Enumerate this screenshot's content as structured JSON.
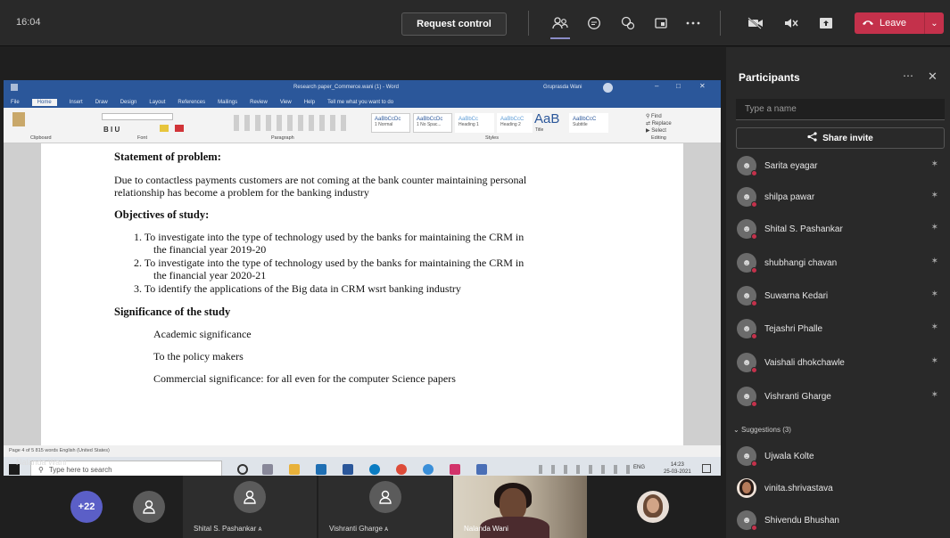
{
  "topbar": {
    "time": "16:04",
    "request_control": "Request control",
    "leave": "Leave",
    "icons": [
      "participants-icon",
      "chat-icon",
      "reactions-icon",
      "rooms-icon",
      "more-icon",
      "camera-off-icon",
      "mic-off-icon",
      "share-tray-icon"
    ]
  },
  "shared_screen": {
    "word_title": "Research paper_Commerce.wani (1) - Word",
    "word_user": "Gruprasda Wani",
    "tabs": [
      "File",
      "Home",
      "Insert",
      "Draw",
      "Design",
      "Layout",
      "References",
      "Mailings",
      "Review",
      "View",
      "Help",
      "Tell me what you want to do"
    ],
    "styles": [
      "AaBbCcDc",
      "AaBbCcDc",
      "AaBbCc",
      "AaBbCcC",
      "AaB",
      "AaBbCcC"
    ],
    "style_names": [
      "1 Normal",
      "1 No Spac...",
      "Heading 1",
      "Heading 2",
      "Title",
      "Subtitle"
    ],
    "ribbon_groups": [
      "Clipboard",
      "Font",
      "Paragraph",
      "Styles",
      "Editing"
    ],
    "doc": {
      "h1": "Statement of problem:",
      "p1a": "Due to contactless payments customers are not coming at the bank counter maintaining personal",
      "p1b": "relationship has become a problem for the banking industry",
      "h2": "Objectives of study:",
      "li1a": "1.  To investigate into the type of technology used by the banks for maintaining the CRM in",
      "li1b": "the financial year 2019-20",
      "li2a": "2.  To investigate into the type of technology used by the banks for maintaining the CRM in",
      "li2b": "the financial year 2020-21",
      "li3": "3.  To identify the applications of the Big data in CRM wsrt banking industry",
      "h3": "Significance of the study",
      "s1": "Academic significance",
      "s2": "To the policy makers",
      "s3": "Commercial significance: for all even for the computer Science papers"
    },
    "statusbar": "Page 4 of 5     815 words     English (United States)",
    "taskbar_search": "Type here to search",
    "taskbar_time": "14:23",
    "taskbar_date": "25-03-2021",
    "taskbar_lang": "ENG"
  },
  "speaker": "Nalanda Wani",
  "strip": {
    "overflow_count": "+22",
    "tiles": [
      "Shital S. Pashankar",
      "Vishranti Gharge",
      "Nalanda Wani"
    ]
  },
  "participants": {
    "title": "Participants",
    "search_placeholder": "Type a name",
    "share_invite": "Share invite",
    "list": [
      "Sarita eyagar",
      "shilpa pawar",
      "Shital S. Pashankar",
      "shubhangi chavan",
      "Suwarna Kedari",
      "Tejashri Phalle",
      "Vaishali dhokchawle",
      "Vishranti Gharge"
    ],
    "suggestions_label": "Suggestions (3)",
    "suggestions": [
      "Ujwala Kolte",
      "vinita.shrivastava",
      "Shivendu Bhushan"
    ]
  },
  "colors": {
    "leave": "#c4314b",
    "accent": "#5b5fc7",
    "word_blue": "#2b579a"
  }
}
